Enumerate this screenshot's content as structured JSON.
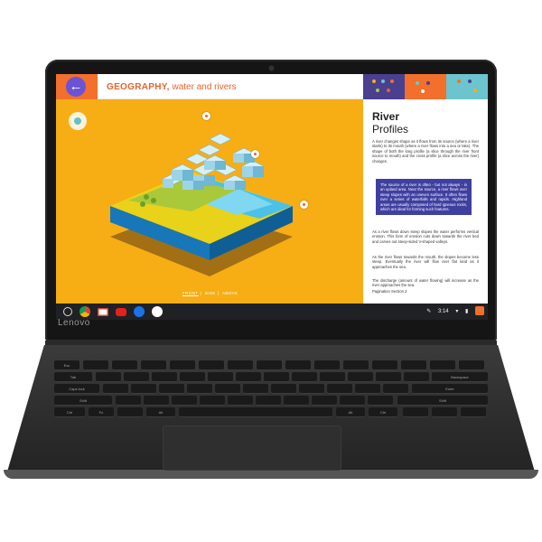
{
  "device": {
    "brand": "Lenovo"
  },
  "app": {
    "header": {
      "subject": "GEOGRAPHY,",
      "topic": "water and rivers",
      "back_icon": "arrow-left-icon"
    },
    "illustration": {
      "view_tabs": [
        "FRONT",
        "SIDE",
        "ABOVE"
      ],
      "active_view": "FRONT",
      "background_color": "#f7ad14"
    },
    "article": {
      "title_line1": "River",
      "title_line2": "Profiles",
      "paragraph1": "A river changes shape as it flows from its source (where a river starts) to its mouth (where a river flows into a sea or lake). The shape of both the long profile (a slice through the river front source to mouth) and the cross profile (a slice across the river) changes.",
      "callout": "The source of a river is often - but not always - in an upland area. Near the source, a river flows over steep slopes with an uneven surface. It often flows over a series of waterfalls and rapids. Highland areas are usually composed of hard igneous rocks, which are ideal for forming such features.",
      "paragraph2": "As a river flows down steep slopes the water performs vertical erosion. This form of erosion cuts down towards the river bed and carves out steep-sided V-shaped valleys.",
      "paragraph3": "As the river flows towards the mouth, the slopes become less steep. Eventually the river will flow over flat land as it approaches the sea.",
      "paragraph4": "The discharge (amount of water flowing) will increase as the river approaches the sea.",
      "pagination": "Pagination Section 2",
      "tile_colors": [
        "#4b3f8f",
        "#f36f2c",
        "#6cc4cf"
      ]
    }
  },
  "shelf": {
    "apps": [
      "chrome-icon",
      "gmail-icon",
      "youtube-icon",
      "files-icon",
      "play-store-icon"
    ],
    "time": "3:14"
  },
  "keyboard": {
    "row_labels": [
      "Esc",
      "Tab",
      "Caps lock",
      "Shift",
      "Ctrl",
      "Fn",
      "Alt",
      "Alt",
      "Ctrl",
      "Enter",
      "Shift",
      "Backspace"
    ]
  }
}
